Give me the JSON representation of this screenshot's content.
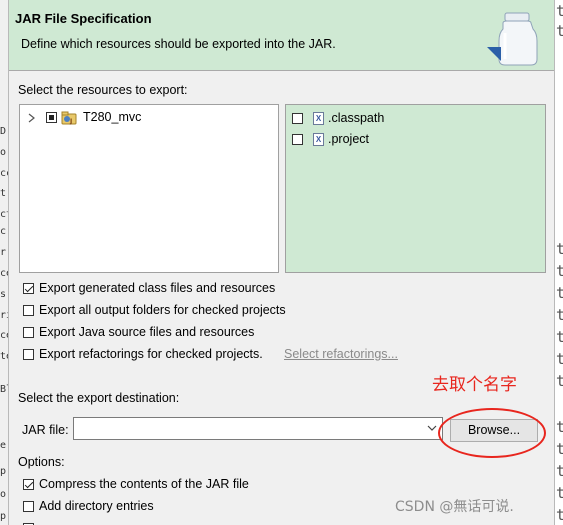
{
  "background": {
    "left_chars": [
      "D",
      "o",
      "cc",
      "t",
      "ct",
      "c",
      "r",
      "ce",
      "s",
      "ri",
      "ce",
      "te",
      "Bl",
      "e",
      "p",
      "o",
      "p"
    ],
    "right_chars": [
      "t",
      "t",
      "t",
      "t",
      "t",
      "t",
      "t",
      "t",
      "t",
      "t",
      "t",
      "t",
      "t",
      "t"
    ]
  },
  "header": {
    "title": "JAR File Specification",
    "description": "Define which resources should be exported into the JAR."
  },
  "resources": {
    "label": "Select the resources to export:",
    "tree": [
      {
        "name": "T280_mvc",
        "expanded": false,
        "state": "partial"
      }
    ],
    "files": [
      {
        "name": ".classpath",
        "checked": false
      },
      {
        "name": ".project",
        "checked": false
      }
    ]
  },
  "options_export": [
    {
      "label": "Export generated class files and resources",
      "checked": true
    },
    {
      "label": "Export all output folders for checked projects",
      "checked": false
    },
    {
      "label": "Export Java source files and resources",
      "checked": false
    },
    {
      "label": "Export refactorings for checked projects.",
      "checked": false
    }
  ],
  "select_refactorings_link": "Select refactorings...",
  "destination": {
    "label": "Select the export destination:",
    "jar_file_label": "JAR file:",
    "jar_file_value": "",
    "browse_label": "Browse..."
  },
  "options": {
    "label": "Options:",
    "items": [
      {
        "label": "Compress the contents of the JAR file",
        "checked": true
      },
      {
        "label": "Add directory entries",
        "checked": false
      }
    ]
  },
  "annotation": {
    "text": "去取个名字",
    "color": "#e8261e"
  },
  "watermark": "CSDN @無话可说."
}
